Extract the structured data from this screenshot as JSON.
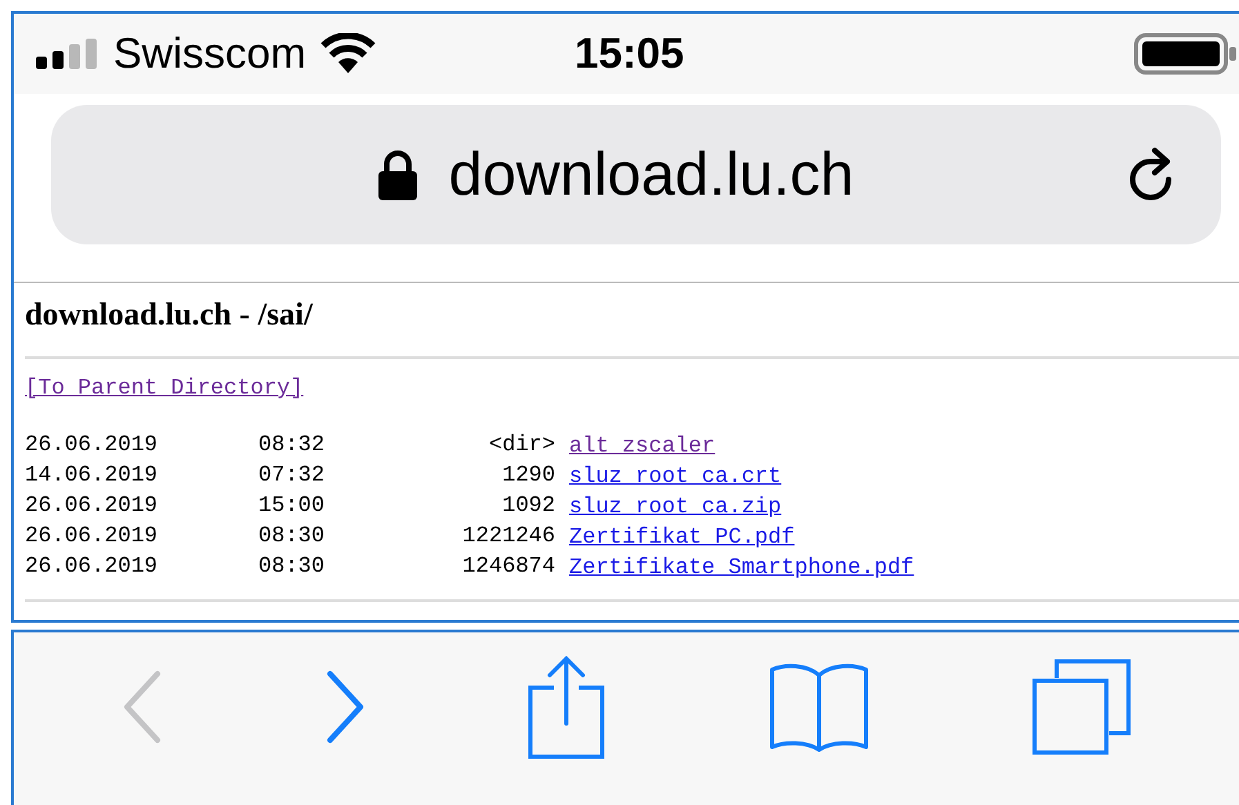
{
  "status_bar": {
    "carrier": "Swisscom",
    "time": "15:05"
  },
  "address_bar": {
    "url": "download.lu.ch"
  },
  "page": {
    "title": "download.lu.ch - /sai/",
    "parent_link": {
      "text": "[To Parent Directory]",
      "visited": true
    },
    "entries": [
      {
        "date": "26.06.2019",
        "time": "08:32",
        "size": "<dir>",
        "name": "alt_zscaler",
        "visited": true
      },
      {
        "date": "14.06.2019",
        "time": "07:32",
        "size": "1290",
        "name": "sluz_root_ca.crt",
        "visited": false
      },
      {
        "date": "26.06.2019",
        "time": "15:00",
        "size": "1092",
        "name": "sluz_root_ca.zip",
        "visited": false
      },
      {
        "date": "26.06.2019",
        "time": "08:30",
        "size": "1221246",
        "name": "Zertifikat_PC.pdf",
        "visited": false
      },
      {
        "date": "26.06.2019",
        "time": "08:30",
        "size": "1246874",
        "name": "Zertifikate_Smartphone.pdf",
        "visited": false
      }
    ]
  },
  "toolbar": {
    "buttons": [
      {
        "kind": "back",
        "disabled": true
      },
      {
        "kind": "forward",
        "disabled": false
      },
      {
        "kind": "share",
        "disabled": false
      },
      {
        "kind": "bookmarks",
        "disabled": false
      },
      {
        "kind": "tabs",
        "disabled": false
      }
    ]
  }
}
